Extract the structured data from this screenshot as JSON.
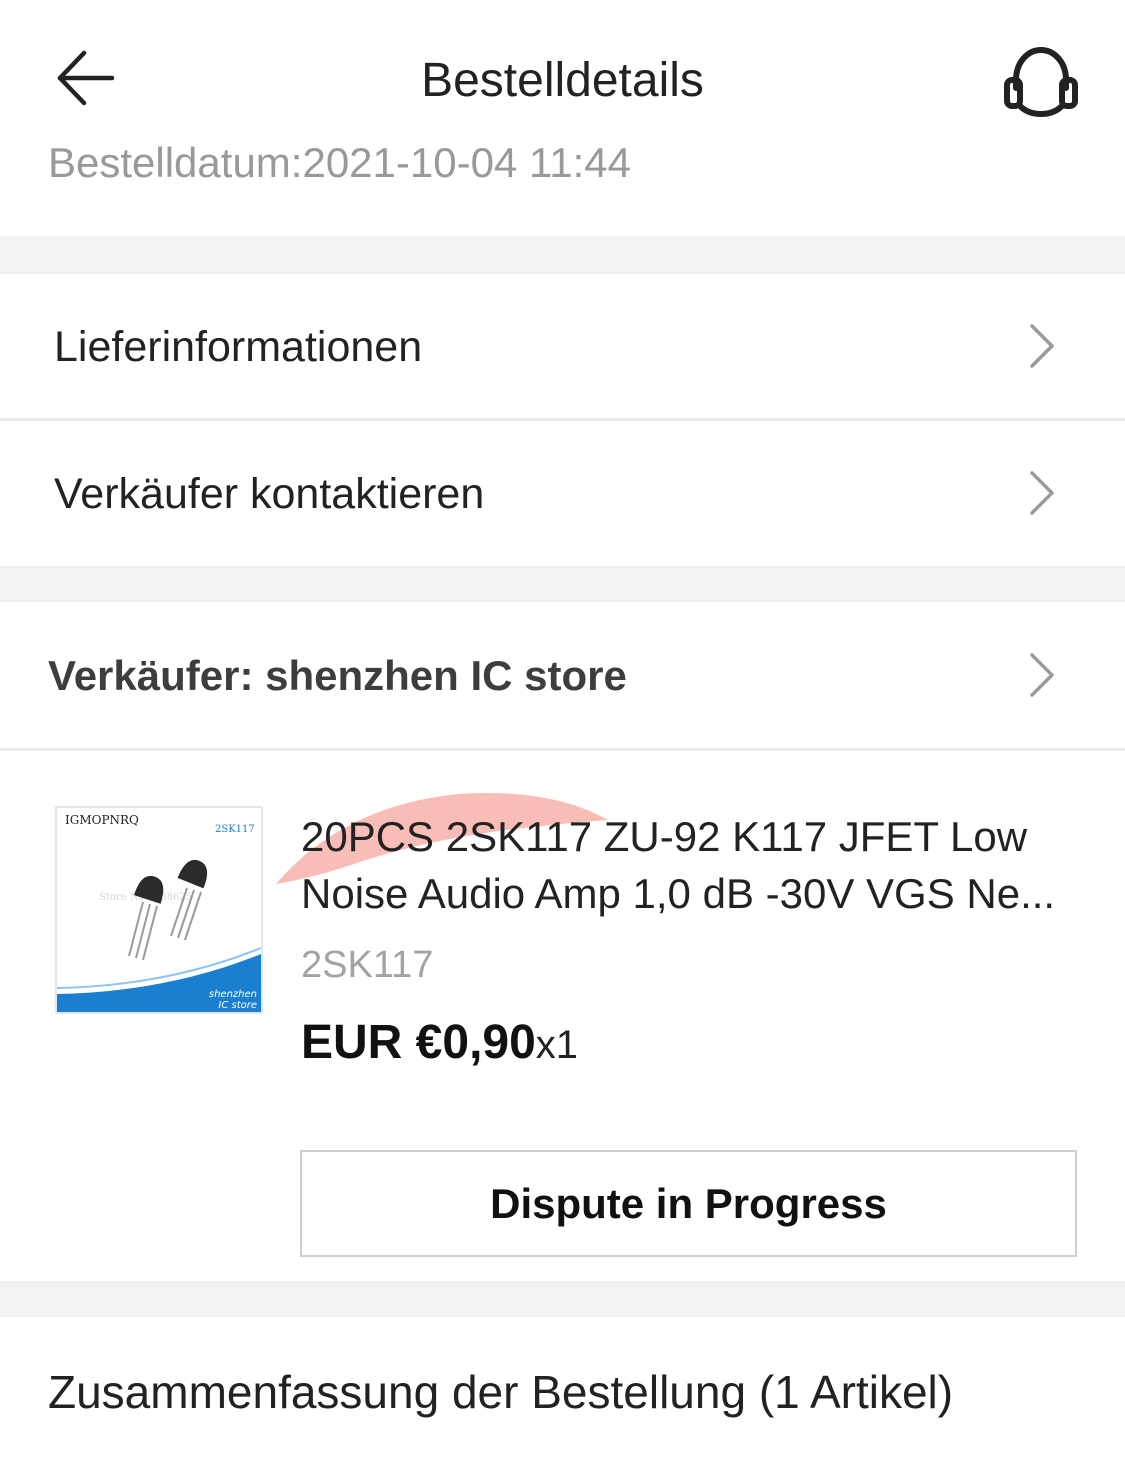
{
  "header": {
    "title": "Bestelldetails",
    "order_date": "Bestelldatum:2021-10-04 11:44"
  },
  "rows": {
    "delivery_info": "Lieferinformationen",
    "contact_seller": "Verkäufer kontaktieren",
    "seller": "Verkäufer: shenzhen IC store"
  },
  "product": {
    "title_line1": "20PCS 2SK117 ZU-92 K117 JFET Low",
    "title_line2": "Noise Audio Amp 1,0 dB -30V VGS Ne...",
    "sku": "2SK117",
    "price": "EUR €0,90",
    "quantity": "x1",
    "image": {
      "brand": "IGMOPNRQ",
      "part": "2SK117",
      "watermark": "Store No.1138625",
      "footer_line1": "shenzhen",
      "footer_line2": "IC store"
    }
  },
  "dispute_button": "Dispute in Progress",
  "summary": {
    "title": "Zusammenfassung der Bestellung (1 Artikel)"
  },
  "colors": {
    "gap_background": "#f2f2f2",
    "muted_text": "#999999",
    "image_accent": "#1a7fd0",
    "highlight_mark": "#f7a7a0"
  }
}
